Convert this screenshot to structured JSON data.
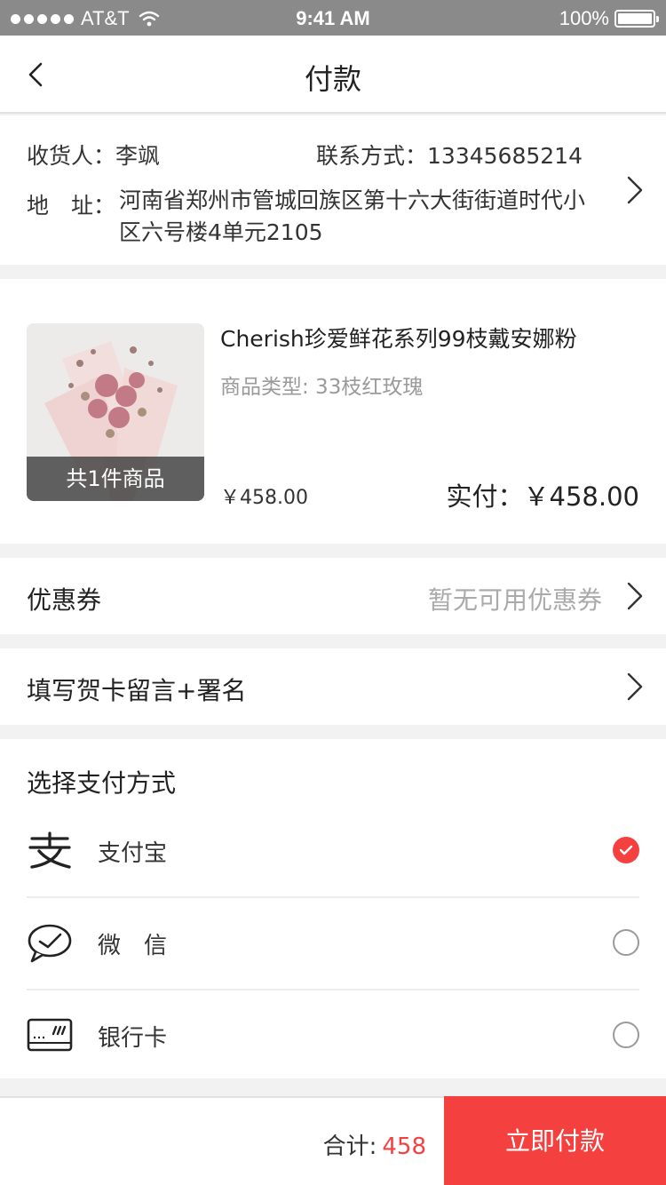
{
  "status_bar": {
    "carrier": "AT&T",
    "time": "9:41 AM",
    "battery": "100%"
  },
  "nav": {
    "title": "付款"
  },
  "address": {
    "receiver_label": "收货人：",
    "receiver_name": "李飒",
    "contact_label": "联系方式：",
    "contact_value": "13345685214",
    "address_label": "地　址：",
    "address_value": "河南省郑州市管城回族区第十六大街街道时代小区六号楼4单元2105"
  },
  "product": {
    "name": "Cherish珍爱鲜花系列99枝戴安娜粉",
    "type_label": "商品类型: 33枝红玫瑰",
    "count_badge": "共1件商品",
    "price": "￥458.00",
    "paid_label": "实付：￥458.00"
  },
  "coupon": {
    "label": "优惠券",
    "value": "暂无可用优惠券"
  },
  "card": {
    "label": "填写贺卡留言+署名"
  },
  "payment": {
    "heading": "选择支付方式",
    "options": [
      {
        "label": "支付宝",
        "icon": "alipay-icon",
        "selected": true
      },
      {
        "label": "微　信",
        "icon": "wechat-icon",
        "selected": false
      },
      {
        "label": "银行卡",
        "icon": "bank-card-icon",
        "selected": false
      }
    ]
  },
  "footer": {
    "total_label": "合计:",
    "total_value": "458",
    "pay_button": "立即付款"
  },
  "colors": {
    "accent": "#f54040",
    "muted": "#9a9a9a",
    "status_bar": "#8a8a8a"
  }
}
